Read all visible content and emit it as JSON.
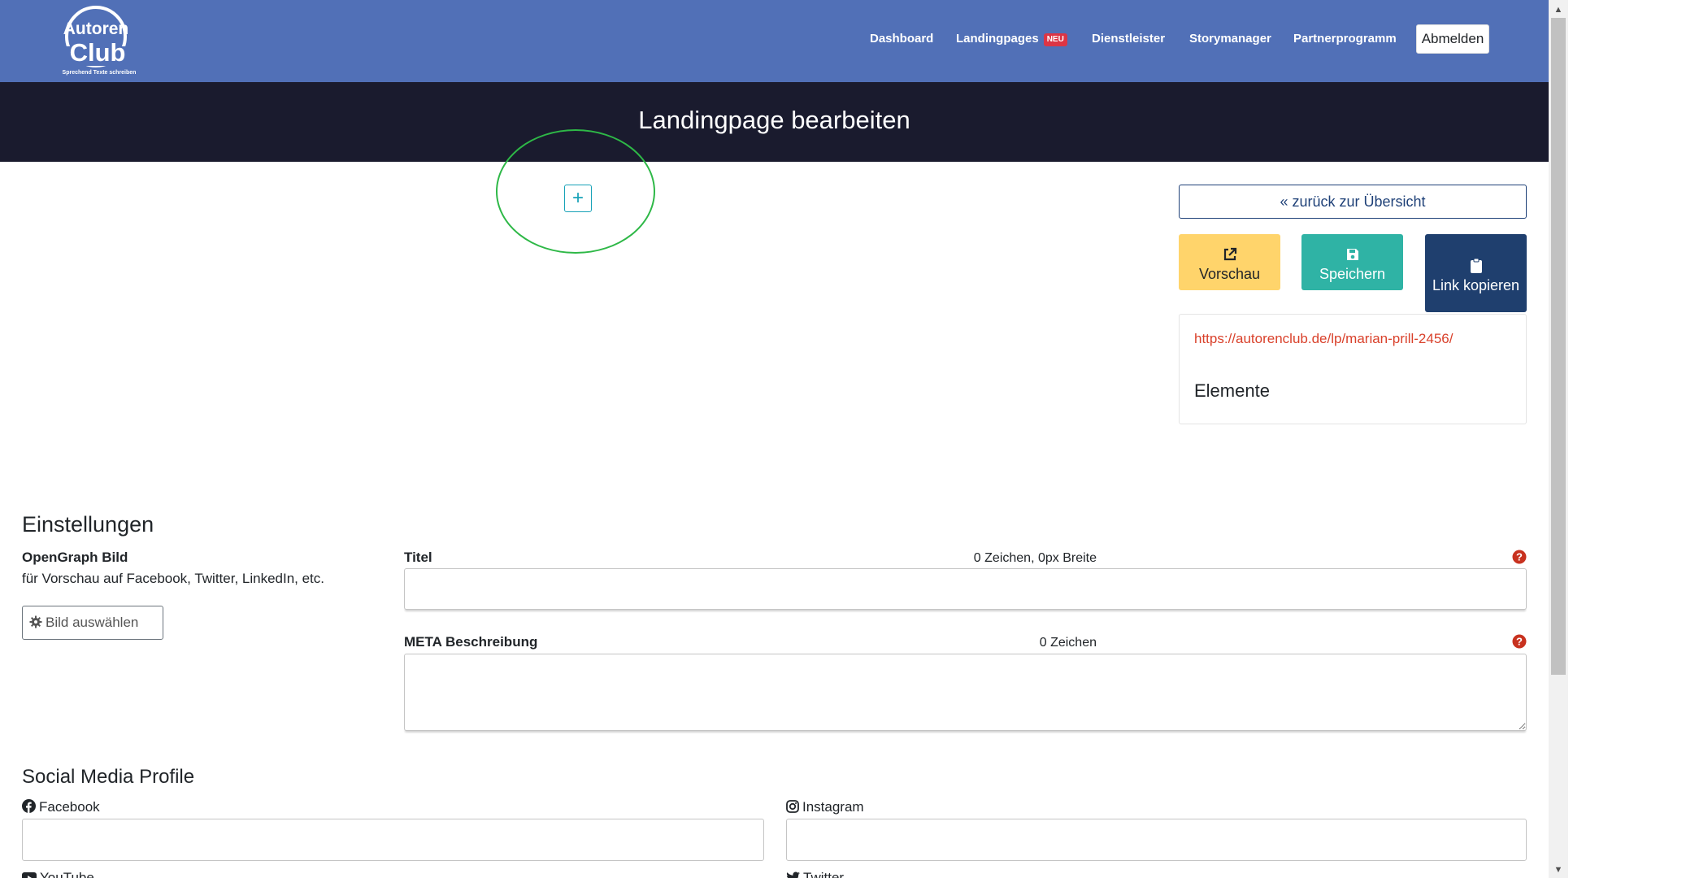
{
  "brand": {
    "logo_top": "Autoren",
    "logo_bottom": "Club",
    "logo_tagline": "Sprechend Texte schreiben"
  },
  "nav": {
    "items": [
      "Dashboard",
      "Landingpages",
      "Dienstleister",
      "Storymanager",
      "Partnerprogramm"
    ],
    "badge": "NEU",
    "logout": "Abmelden"
  },
  "page": {
    "title": "Landingpage bearbeiten",
    "add_button": "+"
  },
  "sidebar": {
    "back": "« zurück zur Übersicht",
    "preview": "Vorschau",
    "save": "Speichern",
    "copy_link": "Link kopieren",
    "url": "https://autorenclub.de/lp/marian-prill-2456/",
    "elements_heading": "Elemente"
  },
  "settings": {
    "heading": "Einstellungen",
    "og_label": "OpenGraph Bild",
    "og_hint": "für Vorschau auf Facebook, Twitter, LinkedIn, etc.",
    "select_image": "Bild auswählen",
    "title_label": "Titel",
    "title_counter": "0 Zeichen, 0px Breite",
    "title_value": "",
    "meta_label": "META Beschreibung",
    "meta_counter": "0 Zeichen",
    "meta_value": ""
  },
  "social": {
    "heading": "Social Media Profile",
    "facebook": "Facebook",
    "instagram": "Instagram",
    "youtube": "YouTube",
    "twitter": "Twitter"
  },
  "colors": {
    "navbar": "#5170b7",
    "title_bar": "#1a1b2e",
    "preview": "#ffd46b",
    "save": "#2fb3a5",
    "copy": "#1f3f6e",
    "annotation": "#2eb847",
    "link": "#d9412b"
  }
}
